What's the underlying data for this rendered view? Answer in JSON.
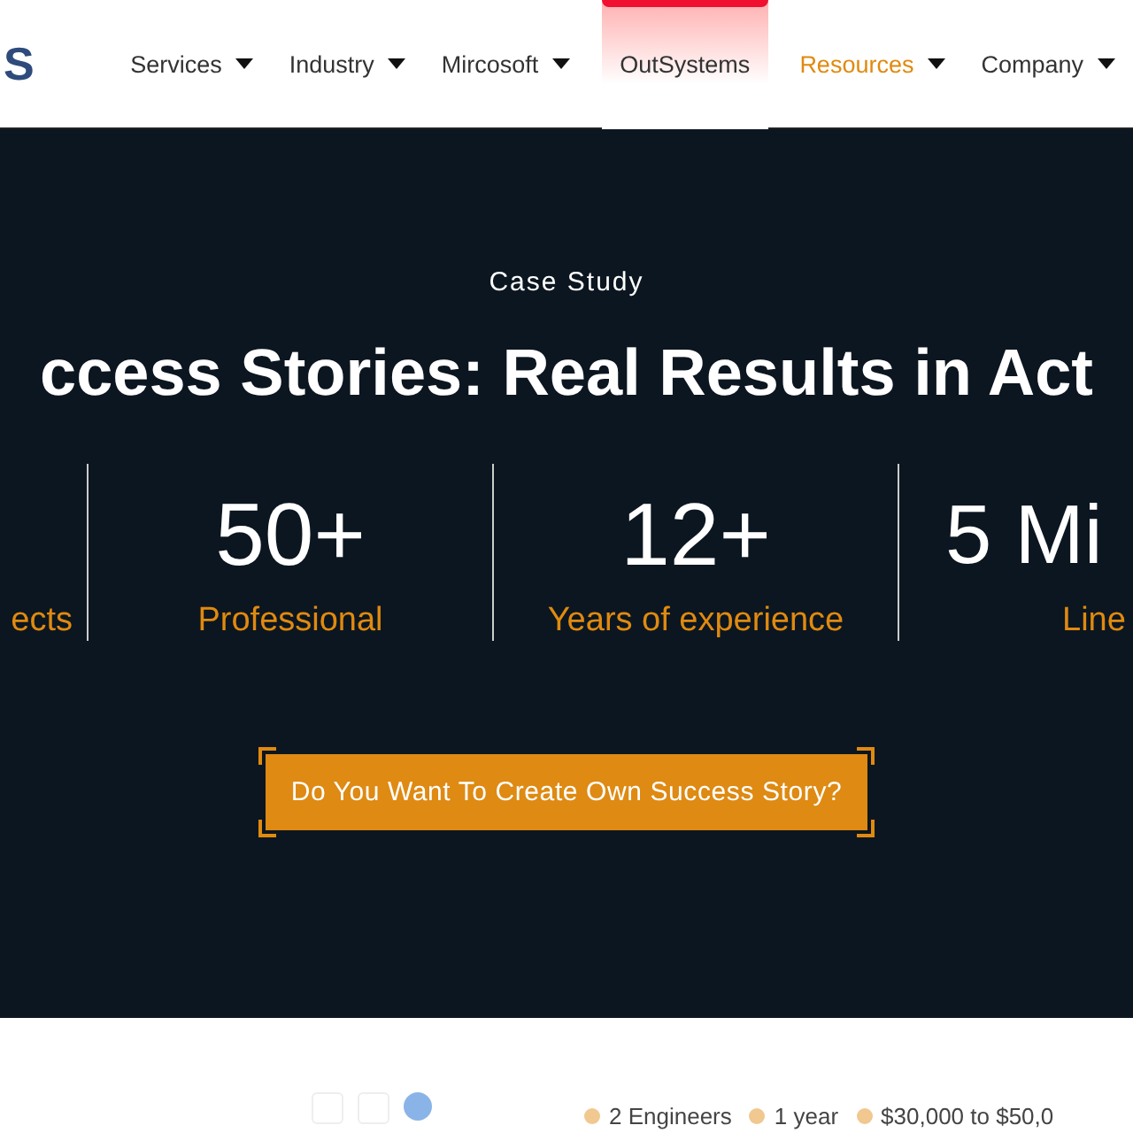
{
  "header": {
    "logo": "S",
    "nav": [
      {
        "label": "Services",
        "dropdown": true,
        "selected": false,
        "highlighted": false
      },
      {
        "label": "Industry",
        "dropdown": true,
        "selected": false,
        "highlighted": false
      },
      {
        "label": "Mircosoft",
        "dropdown": true,
        "selected": false,
        "highlighted": false
      },
      {
        "label": "OutSystems",
        "dropdown": false,
        "selected": false,
        "highlighted": true
      },
      {
        "label": "Resources",
        "dropdown": true,
        "selected": true,
        "highlighted": false
      },
      {
        "label": "Company",
        "dropdown": true,
        "selected": false,
        "highlighted": false
      }
    ]
  },
  "hero": {
    "eyebrow": "Case Study",
    "title": "ccess Stories: Real Results in Act",
    "stats": [
      {
        "label": "ects"
      },
      {
        "number": "50+",
        "label": "Professional"
      },
      {
        "number": "12+",
        "label": "Years of experience"
      },
      {
        "number": "5 Mi",
        "label": "Line"
      }
    ],
    "cta": "Do You Want To Create Own Success Story?"
  },
  "preview": {
    "facts": [
      "2 Engineers",
      "1 year",
      "$30,000 to $50,0"
    ]
  }
}
